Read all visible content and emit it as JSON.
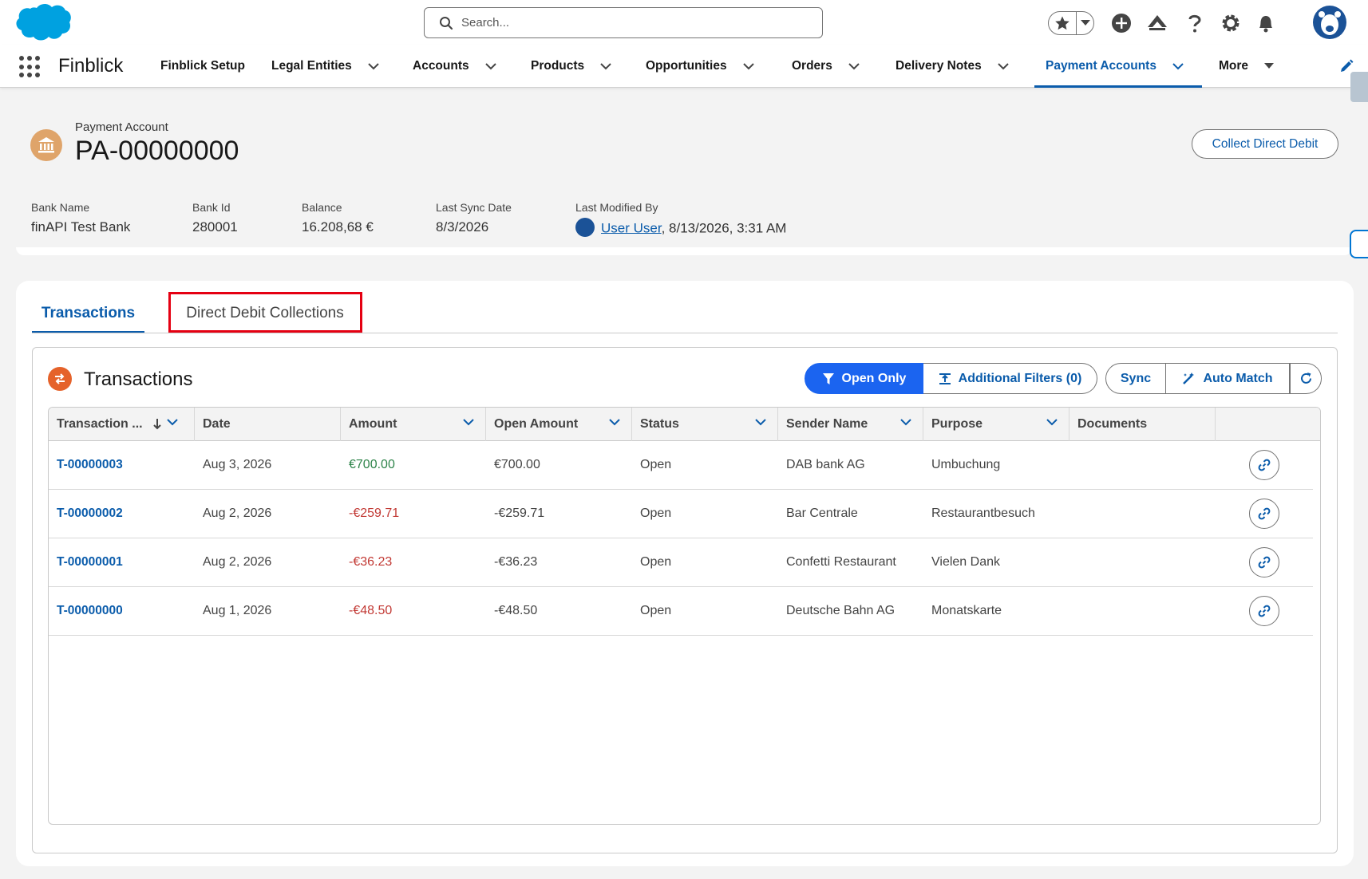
{
  "header": {
    "search_placeholder": "Search..."
  },
  "nav": {
    "app_name": "Finblick",
    "items": [
      {
        "label": "Finblick Setup"
      },
      {
        "label": "Legal Entities"
      },
      {
        "label": "Accounts"
      },
      {
        "label": "Products"
      },
      {
        "label": "Opportunities"
      },
      {
        "label": "Orders"
      },
      {
        "label": "Delivery Notes"
      },
      {
        "label": "Payment Accounts"
      },
      {
        "label": "More"
      }
    ]
  },
  "record": {
    "type": "Payment Account",
    "title": "PA-00000000",
    "action_button": "Collect Direct Debit",
    "fields": [
      {
        "label": "Bank Name",
        "value": "finAPI Test Bank"
      },
      {
        "label": "Bank Id",
        "value": "280001"
      },
      {
        "label": "Balance",
        "value": "16.208,68 €"
      },
      {
        "label": "Last Sync Date",
        "value": "8/3/2026"
      },
      {
        "label": "Last Modified By",
        "user": "User User",
        "value": ", 8/13/2026, 3:31 AM"
      }
    ]
  },
  "tabs": [
    {
      "label": "Transactions"
    },
    {
      "label": "Direct Debit Collections"
    }
  ],
  "transactions": {
    "title": "Transactions",
    "buttons": {
      "open_only": "Open Only",
      "additional_filters": "Additional Filters (0)",
      "sync": "Sync",
      "auto_match": "Auto Match"
    },
    "columns": [
      "Transaction ...",
      "Date",
      "Amount",
      "Open Amount",
      "Status",
      "Sender Name",
      "Purpose",
      "Documents"
    ],
    "rows": [
      {
        "id": "T-00000003",
        "date": "Aug 3, 2026",
        "amount": "€700.00",
        "open_amount": "€700.00",
        "status": "Open",
        "sender": "DAB bank AG",
        "purpose": "Umbuchung",
        "documents": ""
      },
      {
        "id": "T-00000002",
        "date": "Aug 2, 2026",
        "amount": "-€259.71",
        "open_amount": "-€259.71",
        "status": "Open",
        "sender": "Bar Centrale",
        "purpose": "Restaurantbesuch",
        "documents": ""
      },
      {
        "id": "T-00000001",
        "date": "Aug 2, 2026",
        "amount": "-€36.23",
        "open_amount": "-€36.23",
        "status": "Open",
        "sender": "Confetti Restaurant",
        "purpose": "Vielen Dank",
        "documents": ""
      },
      {
        "id": "T-00000000",
        "date": "Aug 1, 2026",
        "amount": "-€48.50",
        "open_amount": "-€48.50",
        "status": "Open",
        "sender": "Deutsche Bahn AG",
        "purpose": "Monatskarte",
        "documents": ""
      }
    ]
  },
  "colors": {
    "brand_blue": "#0b5cab",
    "primary_button": "#1b64f0",
    "positive": "#2e844a",
    "negative": "#c23934",
    "highlight": "#e50012",
    "record_icon": "#dfa46a",
    "transactions_icon": "#e5622a"
  }
}
